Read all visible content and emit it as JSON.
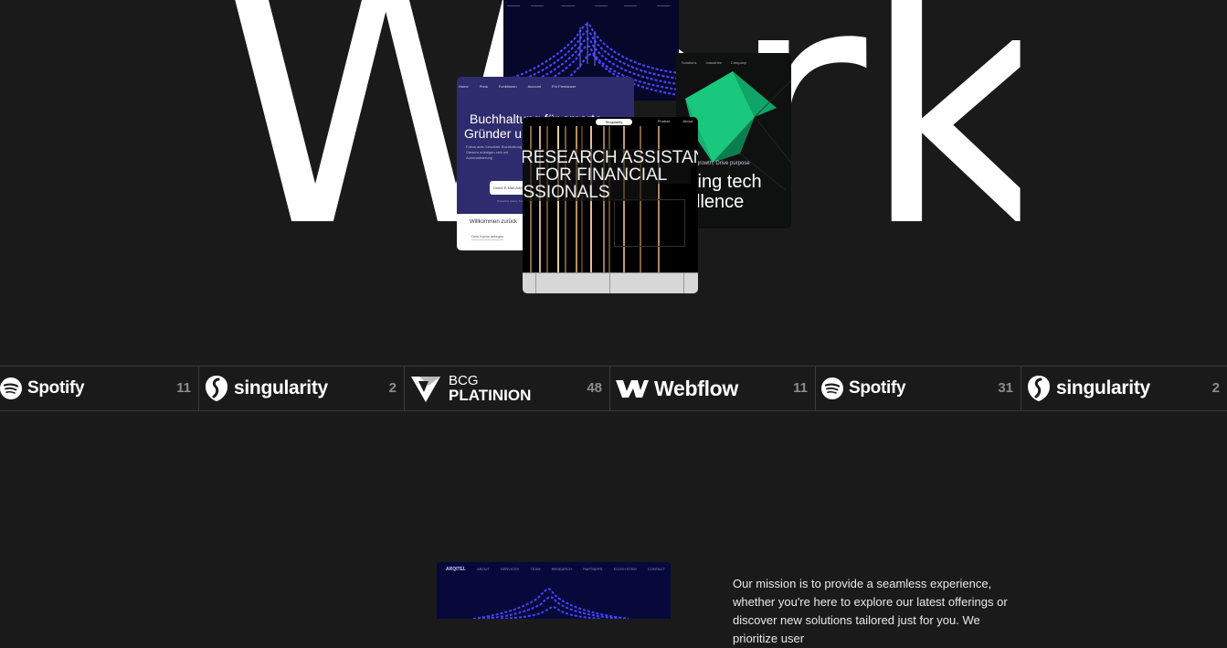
{
  "hero": {
    "word": "Work"
  },
  "cards": {
    "wave": {
      "icon": "wave-chart-illustration"
    },
    "green": {
      "nav": [
        "Solutions",
        "Industries",
        "Company"
      ],
      "tagline": "growth, Drive purpose",
      "headline_line1": "ting tech",
      "headline_line2": "llence",
      "icon": "green-crystal-illustration"
    },
    "accounting": {
      "nav": [
        "Home",
        "Preis",
        "Funktionen",
        "Account",
        "Für Freelancer"
      ],
      "title_line1": "Buchhaltung für smarte",
      "title_line2": "Gründer u",
      "subtitle": "Fokus aufs Geschäft. Buchhaltung und Steuern erledigen sich mit Automatisierung",
      "email_placeholder": "Deine E-Mail-Adresse",
      "fine_print": "Kostenlos testen. Keine Kreditkarte nötig.",
      "panel_heading": "Willkommen zurück",
      "panel_field": "Dein Konto anlegen"
    },
    "research": {
      "pill": "Singularity",
      "nav": [
        "Product",
        "About"
      ],
      "headline_line1": "RESEARCH ASSISTANT",
      "headline_line2": "FOR FINANCIAL",
      "headline_line3": "SSIONALS"
    }
  },
  "clients": [
    {
      "name": "Spotify",
      "count": "11",
      "icon": "spotify-icon"
    },
    {
      "name": "singularity",
      "count": "2",
      "icon": "singularity-icon"
    },
    {
      "name_top": "BCG",
      "name_bottom": "PLATINION",
      "count": "48",
      "icon": "bcg-platinion-icon"
    },
    {
      "name": "Webflow",
      "count": "11",
      "icon": "webflow-icon"
    },
    {
      "name": "Spotify",
      "count": "31",
      "icon": "spotify-icon"
    },
    {
      "name": "singularity",
      "count": "2",
      "icon": "singularity-icon"
    }
  ],
  "preview": {
    "brand": "ARQITEL",
    "nav": [
      "ABOUT",
      "SERVICES",
      "TEAM",
      "RESEARCH",
      "PARTNERS",
      "ECOSYSTEM",
      "CONTACT"
    ]
  },
  "mission": {
    "text": "Our mission is to provide a seamless experience, whether you're here to explore our latest offerings or discover new solutions tailored just for you. We prioritize user"
  },
  "colors": {
    "background": "#1a1a1b",
    "divider": "#3a3a3c",
    "count": "#8d8d90",
    "wave_blue": "#3b3bff",
    "green_accent": "#1ee08c",
    "acct_purple": "#2e2c6e"
  }
}
